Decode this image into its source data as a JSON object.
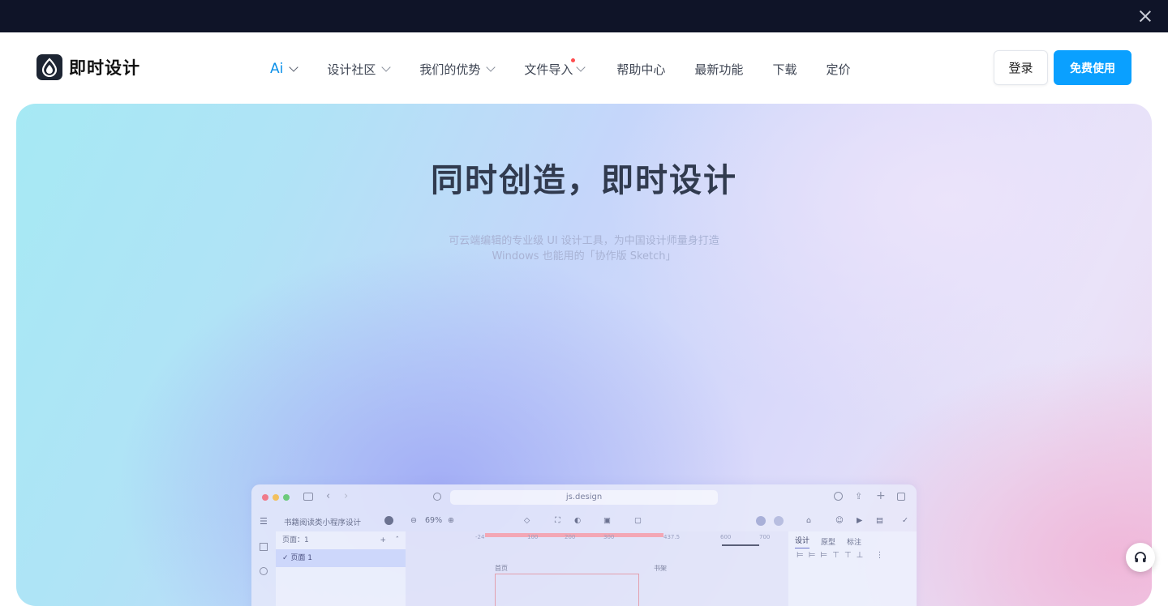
{
  "banner": {
    "close_icon": "close-icon"
  },
  "brand": {
    "name": "即时设计",
    "logo_icon": "logo-drop-icon",
    "logo_bg": "#1d2533"
  },
  "nav": {
    "items": [
      {
        "label": "Ai",
        "dropdown": true
      },
      {
        "label": "设计社区",
        "dropdown": true
      },
      {
        "label": "我们的优势",
        "dropdown": true
      },
      {
        "label": "文件导入",
        "dropdown": true,
        "badge_dot": true
      },
      {
        "label": "帮助中心",
        "dropdown": false
      },
      {
        "label": "最新功能",
        "dropdown": false
      },
      {
        "label": "下载",
        "dropdown": false
      },
      {
        "label": "定价",
        "dropdown": false
      }
    ],
    "login_label": "登录",
    "free_label": "免费使用",
    "accent": "#0aa0ff"
  },
  "hero": {
    "title": "同时创造，即时设计",
    "subtitle_line1": "可云端编辑的专业级 UI 设计工具，为中国设计师量身打造",
    "subtitle_line2": "Windows 也能用的「协作版 Sketch」"
  },
  "preview": {
    "url": "js.design",
    "project_name": "书籍阅读类小程序设计",
    "zoom": "69%",
    "pages_label": "页面：1",
    "page_item": "页面 1",
    "right_tabs": [
      "设计",
      "原型",
      "标注"
    ],
    "ruler_labels": [
      "-24",
      "100",
      "200",
      "300",
      "437.5",
      "600",
      "700"
    ],
    "frame_labels": [
      "首页",
      "书架"
    ]
  },
  "help": {
    "icon": "headset-icon"
  }
}
